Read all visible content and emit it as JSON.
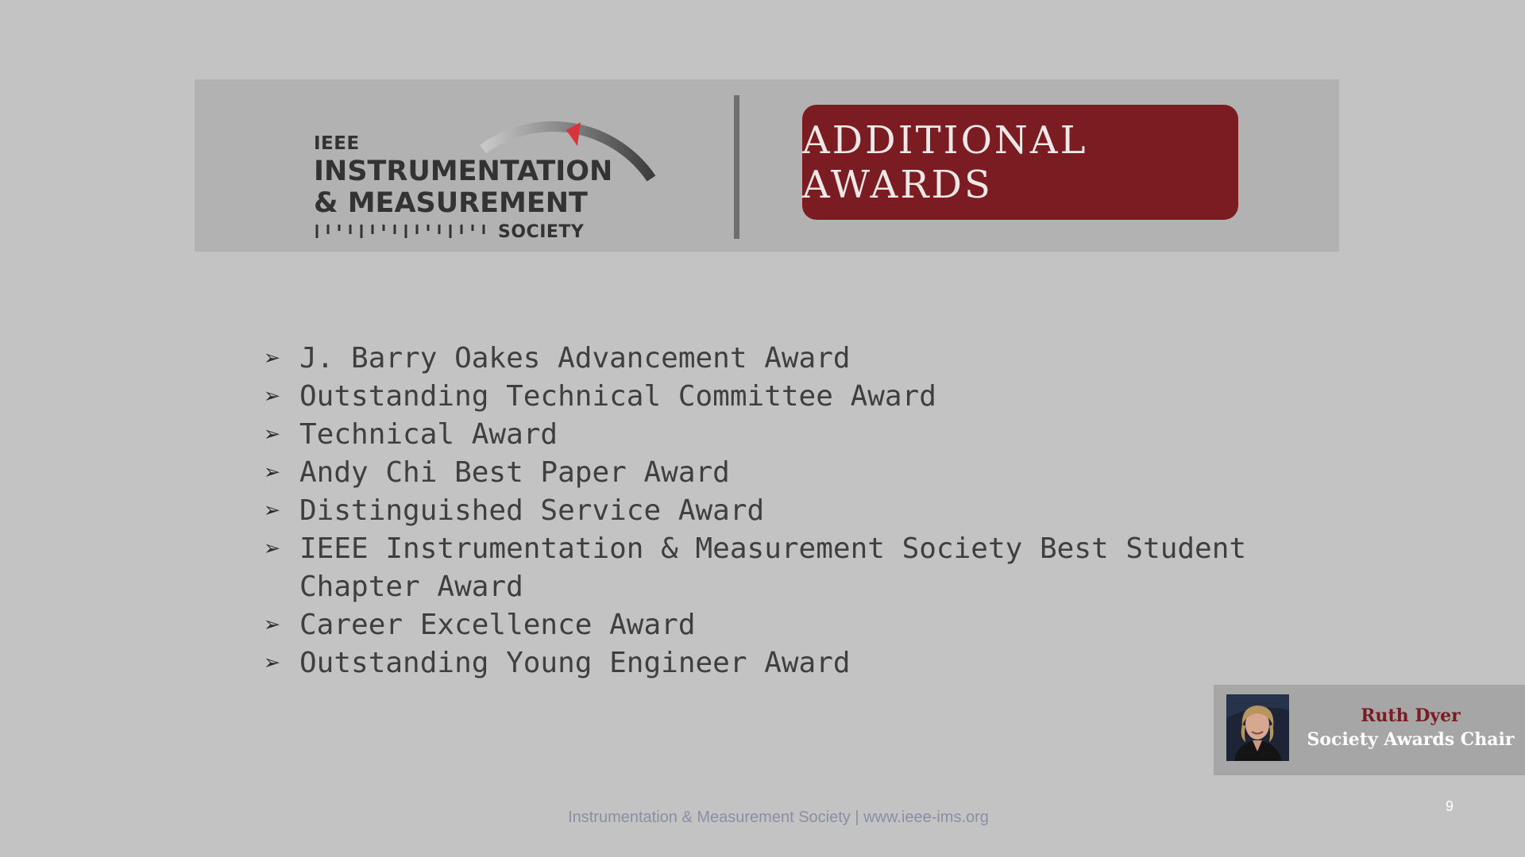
{
  "logo": {
    "ieee": "IEEE",
    "line1": "INSTRUMENTATION",
    "line2": "& MEASUREMENT",
    "society": "SOCIETY"
  },
  "title": "ADDITIONAL AWARDS",
  "awards": [
    "J. Barry Oakes Advancement Award",
    "Outstanding Technical Committee Award",
    "Technical Award",
    "Andy Chi Best Paper Award",
    "Distinguished Service Award",
    "IEEE Instrumentation & Measurement Society Best Student Chapter Award",
    "Career Excellence Award",
    "Outstanding Young Engineer Award"
  ],
  "bullet_icon": "arrowhead-bullet-icon",
  "person": {
    "name": "Ruth Dyer",
    "role": "Society Awards Chair"
  },
  "footer": "Instrumentation & Measurement Society | www.ieee-ims.org",
  "page_number": "9",
  "colors": {
    "background": "#c3c3c3",
    "banner": "#b2b2b2",
    "title_box": "#7b1b22",
    "name_accent": "#7b1b22",
    "logo_needle": "#d8343b"
  }
}
